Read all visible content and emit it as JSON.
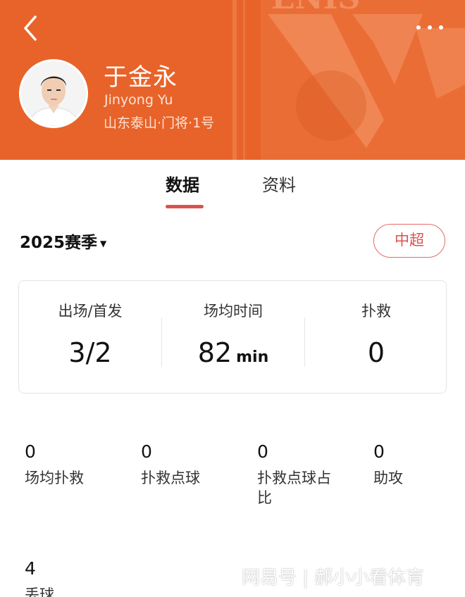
{
  "header": {
    "player_name": "于金永",
    "english_name": "Jinyong Yu",
    "team_info": "山东泰山·门将·1号",
    "background_color": "#e8632a",
    "icons": {
      "back": "chevron-left-icon",
      "more": "more-dots-icon"
    }
  },
  "tabs": [
    {
      "label": "数据",
      "active": true
    },
    {
      "label": "资料",
      "active": false
    }
  ],
  "season": {
    "label": "2025赛季",
    "dropdown_icon": "caret-down-icon"
  },
  "league_button": {
    "label": "中超",
    "color": "#d9534f"
  },
  "summary": [
    {
      "label": "出场/首发",
      "value": "3/2",
      "unit": ""
    },
    {
      "label": "场均时间",
      "value": "82",
      "unit": "min"
    },
    {
      "label": "扑救",
      "value": "0",
      "unit": ""
    }
  ],
  "stats": [
    {
      "value": "0",
      "label": "场均扑救"
    },
    {
      "value": "0",
      "label": "扑救点球"
    },
    {
      "value": "0",
      "label": "扑救点球占比"
    },
    {
      "value": "0",
      "label": "助攻"
    },
    {
      "value": "4",
      "label": "丢球"
    }
  ],
  "watermark": "网易号 | 郝小小看体育"
}
